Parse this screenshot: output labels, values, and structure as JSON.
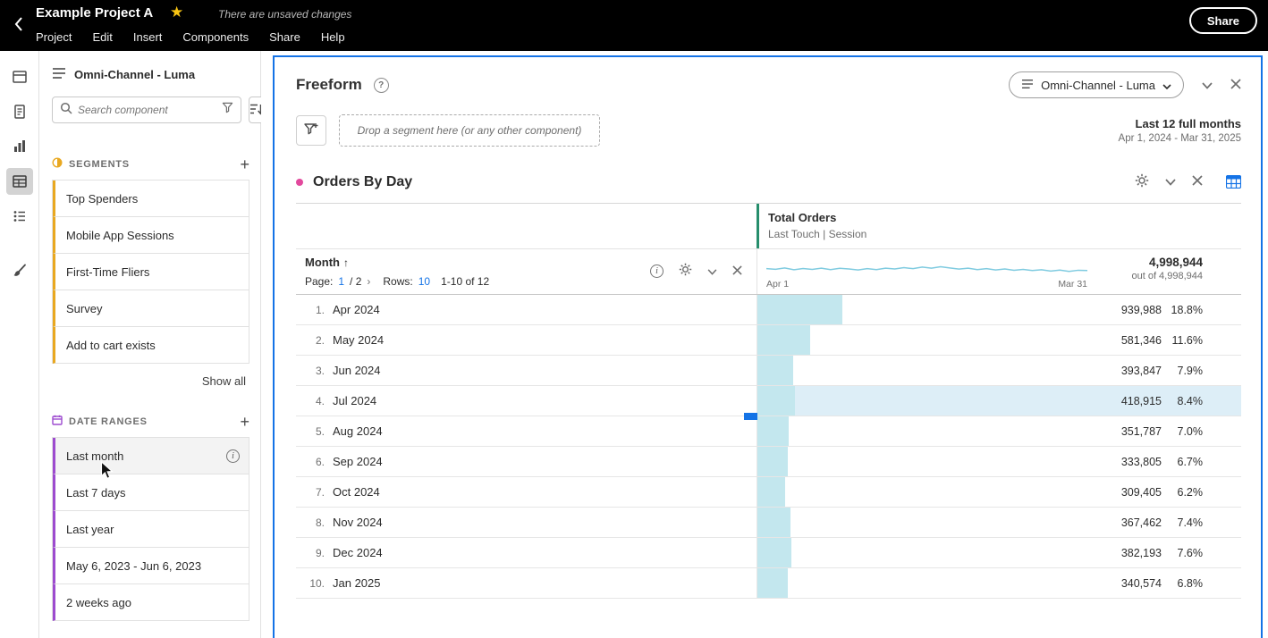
{
  "topbar": {
    "title": "Example Project A",
    "unsaved": "There are unsaved changes",
    "menu": [
      "Project",
      "Edit",
      "Insert",
      "Components",
      "Share",
      "Help"
    ],
    "share": "Share"
  },
  "sidebar": {
    "dataset": "Omni-Channel - Luma",
    "search_placeholder": "Search component",
    "segments_title": "SEGMENTS",
    "segments": [
      "Top Spenders",
      "Mobile App Sessions",
      "First-Time Fliers",
      "Survey",
      "Add to cart exists"
    ],
    "show_all": "Show all",
    "dateranges_title": "DATE RANGES",
    "dateranges": [
      "Last month",
      "Last 7 days",
      "Last year",
      "May 6, 2023 - Jun 6, 2023",
      "2 weeks ago"
    ]
  },
  "panel": {
    "title": "Freeform",
    "help": "?",
    "chip": "Omni-Channel - Luma",
    "dropzone": "Drop a segment here (or any other component)",
    "range_title": "Last 12 full months",
    "range_dates": "Apr 1, 2024 - Mar 31, 2025"
  },
  "table": {
    "title": "Orders By Day",
    "metric": "Total Orders",
    "metric_sub": "Last Touch | Session",
    "dim": "Month",
    "sort_arrow": "↑",
    "page_label": "Page:",
    "page_current": "1",
    "page_total": "/ 2",
    "page_next": "›",
    "rows_label": "Rows:",
    "rows_value": "10",
    "rows_range": "1-10 of 12",
    "spark_left": "Apr 1",
    "spark_right": "Mar 31",
    "total_value": "4,998,944",
    "total_sub": "out of 4,998,944",
    "rows": [
      {
        "idx": "1.",
        "month": "Apr 2024",
        "value": "939,988",
        "pct": "18.8%",
        "pct_num": 18.8
      },
      {
        "idx": "2.",
        "month": "May 2024",
        "value": "581,346",
        "pct": "11.6%",
        "pct_num": 11.6
      },
      {
        "idx": "3.",
        "month": "Jun 2024",
        "value": "393,847",
        "pct": "7.9%",
        "pct_num": 7.9
      },
      {
        "idx": "4.",
        "month": "Jul 2024",
        "value": "418,915",
        "pct": "8.4%",
        "pct_num": 8.4,
        "highlight": true
      },
      {
        "idx": "5.",
        "month": "Aug 2024",
        "value": "351,787",
        "pct": "7.0%",
        "pct_num": 7.0
      },
      {
        "idx": "6.",
        "month": "Sep 2024",
        "value": "333,805",
        "pct": "6.7%",
        "pct_num": 6.7
      },
      {
        "idx": "7.",
        "month": "Oct 2024",
        "value": "309,405",
        "pct": "6.2%",
        "pct_num": 6.2
      },
      {
        "idx": "8.",
        "month": "Nov 2024",
        "value": "367,462",
        "pct": "7.4%",
        "pct_num": 7.4
      },
      {
        "idx": "9.",
        "month": "Dec 2024",
        "value": "382,193",
        "pct": "7.6%",
        "pct_num": 7.6
      },
      {
        "idx": "10.",
        "month": "Jan 2025",
        "value": "340,574",
        "pct": "6.8%",
        "pct_num": 6.8
      }
    ],
    "sparkline": [
      0.52,
      0.48,
      0.56,
      0.45,
      0.53,
      0.47,
      0.55,
      0.46,
      0.54,
      0.5,
      0.44,
      0.52,
      0.46,
      0.55,
      0.5,
      0.58,
      0.52,
      0.62,
      0.55,
      0.64,
      0.56,
      0.49,
      0.55,
      0.46,
      0.52,
      0.44,
      0.5,
      0.42,
      0.47,
      0.4,
      0.45,
      0.37,
      0.43,
      0.35,
      0.42,
      0.4
    ]
  },
  "colors": {
    "accent_blue": "#1473e6",
    "segment_orange": "#e9a820",
    "daterange_purple": "#9d4bcf",
    "metric_green": "#268e6c",
    "bar_cyan": "#c3e7ee",
    "row_highlight": "#ddeef7",
    "spark_blue": "#7fcbe0",
    "viz_dot_magenta": "#e2499d",
    "star_gold": "#f9c513"
  },
  "icons": [
    "back-chevron-icon",
    "favorite-star-icon",
    "search-icon",
    "filter-icon",
    "sort-icon",
    "add-icon",
    "segment-icon",
    "calendar-icon",
    "dataset-icon",
    "help-icon",
    "chevron-down-icon",
    "close-icon",
    "gear-icon",
    "info-icon",
    "data-table-icon",
    "panels-icon",
    "components-icon",
    "visualizations-icon",
    "tables-icon",
    "outline-icon",
    "styling-icon",
    "mouse-cursor"
  ]
}
